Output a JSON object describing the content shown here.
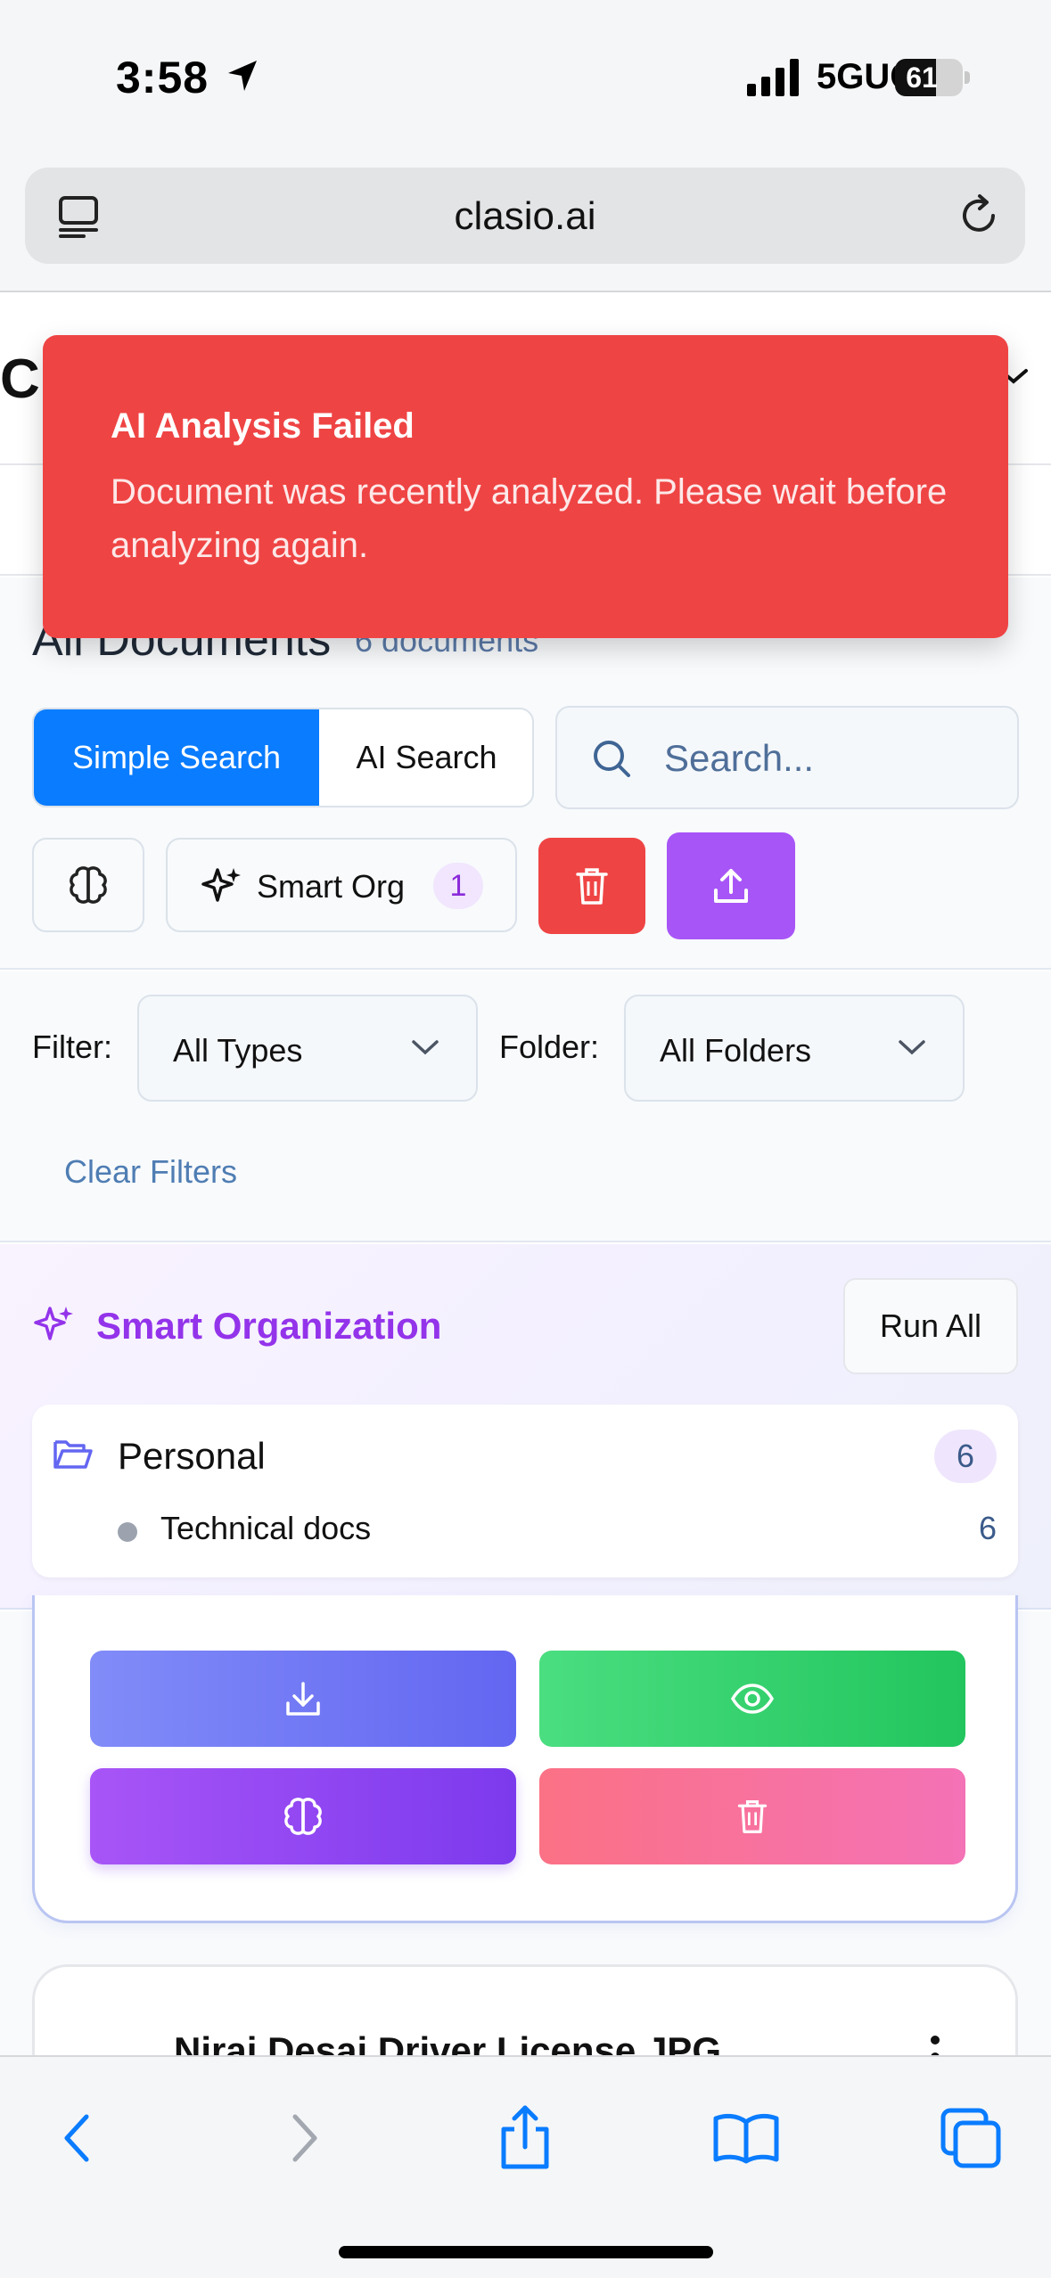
{
  "status_bar": {
    "time": "3:58",
    "network": "5GUC",
    "battery_level": "61",
    "battery_fraction": 0.61
  },
  "browser": {
    "url": "clasio.ai",
    "tabs_icon": "tabs-icon",
    "reload_icon": "reload-icon"
  },
  "header": {
    "logo_partial": "C"
  },
  "toast": {
    "title": "AI Analysis Failed",
    "message": "Document was recently analyzed. Please wait before analyzing again.",
    "color": "#ef4444"
  },
  "documents": {
    "title": "All Documents",
    "count_label": "6 documents",
    "search_modes": [
      "Simple Search",
      "AI Search"
    ],
    "active_search_mode": "Simple Search",
    "search_placeholder": "Search...",
    "smart_org_label": "Smart Org",
    "smart_org_badge": "1",
    "accent_blue": "#0a7cff",
    "delete_color": "#ef4444",
    "upload_color": "#a855f7"
  },
  "filters": {
    "filter_label": "Filter:",
    "type_value": "All Types",
    "folder_label": "Folder:",
    "folder_value": "All Folders",
    "clear_label": "Clear Filters"
  },
  "smart_organization": {
    "title": "Smart Organization",
    "run_all_label": "Run All",
    "folders": [
      {
        "name": "Personal",
        "count": "6",
        "subfolders": [
          {
            "name": "Technical docs",
            "count": "6"
          }
        ]
      }
    ]
  },
  "document_cards": [
    {
      "actions": [
        "download-icon",
        "eye-icon",
        "brain-icon",
        "trash-icon"
      ]
    },
    {
      "name": "Niraj Desai Driver License.JPG"
    }
  ],
  "toolbar": {
    "items": [
      "back-icon",
      "forward-icon",
      "share-icon",
      "bookmarks-icon",
      "tabs-icon"
    ]
  }
}
